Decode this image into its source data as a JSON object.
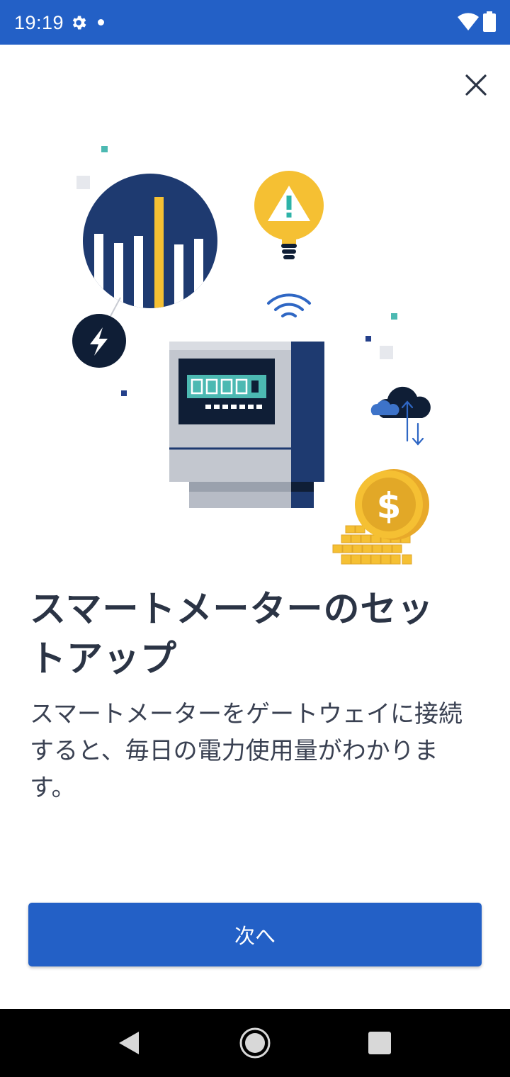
{
  "status_bar": {
    "time": "19:19"
  },
  "icons": {
    "gear": "gear-icon",
    "wifi": "wifi-icon",
    "battery": "battery-icon",
    "close": "close-icon",
    "back": "back-icon",
    "home": "home-icon",
    "recents": "recents-icon"
  },
  "illustration": {
    "coin_symbol": "$"
  },
  "content": {
    "title": "スマートメーターのセットアップ",
    "body": "スマートメーターをゲートウェイに接続すると、毎日の電力使用量がわかります。"
  },
  "actions": {
    "next_label": "次へ"
  },
  "colors": {
    "primary": "#2360c6",
    "navy": "#1e3a70",
    "yellow": "#f5c033",
    "dark": "#0f1e36",
    "teal": "#4cb9b2"
  }
}
